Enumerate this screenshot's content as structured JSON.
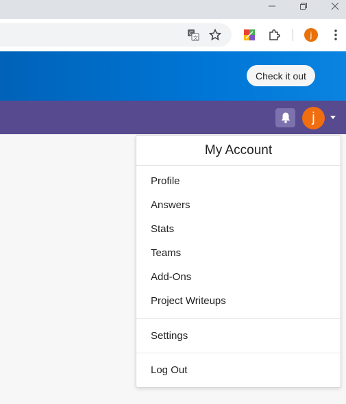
{
  "browser": {
    "window_controls": [
      "minimize",
      "restore",
      "close"
    ],
    "toolbar_icons": [
      "translate-icon",
      "bookmark-star-icon",
      "extension-app-icon",
      "extensions-puzzle-icon",
      "profile-avatar",
      "more-menu-icon"
    ],
    "profile_initial": "j"
  },
  "site": {
    "cta_label": "Check it out",
    "navbar": {
      "notifications_icon": "bell-icon",
      "user_initial": "j"
    }
  },
  "account_menu": {
    "title": "My Account",
    "items": [
      {
        "label": "Profile"
      },
      {
        "label": "Answers"
      },
      {
        "label": "Stats"
      },
      {
        "label": "Teams"
      },
      {
        "label": "Add-Ons"
      },
      {
        "label": "Project Writeups"
      }
    ],
    "settings_label": "Settings",
    "logout_label": "Log Out"
  },
  "colors": {
    "hero_blue": "#0076d6",
    "navbar_purple": "#574a8e",
    "avatar_orange": "#f06d10"
  }
}
